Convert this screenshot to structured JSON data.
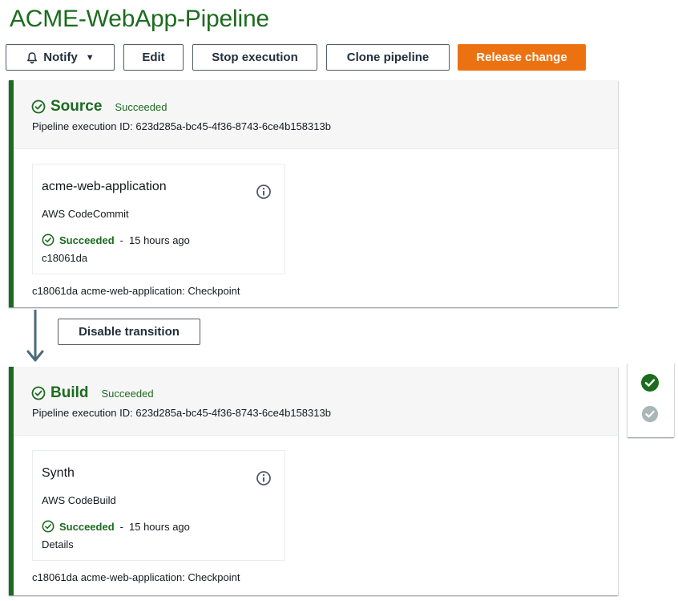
{
  "pipeline": {
    "title": "ACME-WebApp-Pipeline"
  },
  "toolbar": {
    "notify_label": "Notify",
    "edit_label": "Edit",
    "stop_label": "Stop execution",
    "clone_label": "Clone pipeline",
    "release_label": "Release change"
  },
  "colors": {
    "success": "#1d6b1f",
    "primary": "#ec7211",
    "header_bg": "#f6f6f7",
    "disabled": "#aab7b8"
  },
  "stages": [
    {
      "name": "Source",
      "status": "Succeeded",
      "execution_id": "Pipeline execution ID: 623d285a-bc45-4f36-8743-6ce4b158313b",
      "action": {
        "name": "acme-web-application",
        "provider": "AWS CodeCommit",
        "status": "Succeeded",
        "separator": "-",
        "time": "15 hours ago",
        "extra": "c18061da"
      },
      "commit": "c18061da  acme-web-application: Checkpoint"
    },
    {
      "name": "Build",
      "status": "Succeeded",
      "execution_id": "Pipeline execution ID: 623d285a-bc45-4f36-8743-6ce4b158313b",
      "action": {
        "name": "Synth",
        "provider": "AWS CodeBuild",
        "status": "Succeeded",
        "separator": "-",
        "time": "15 hours ago",
        "extra": "Details"
      },
      "commit": "c18061da  acme-web-application: Checkpoint"
    }
  ],
  "transition": {
    "label": "Disable transition"
  },
  "icons": {
    "bell": "bell-icon",
    "check_circle": "check-circle-icon",
    "info": "info-icon",
    "arrow_down": "arrow-down-icon"
  }
}
